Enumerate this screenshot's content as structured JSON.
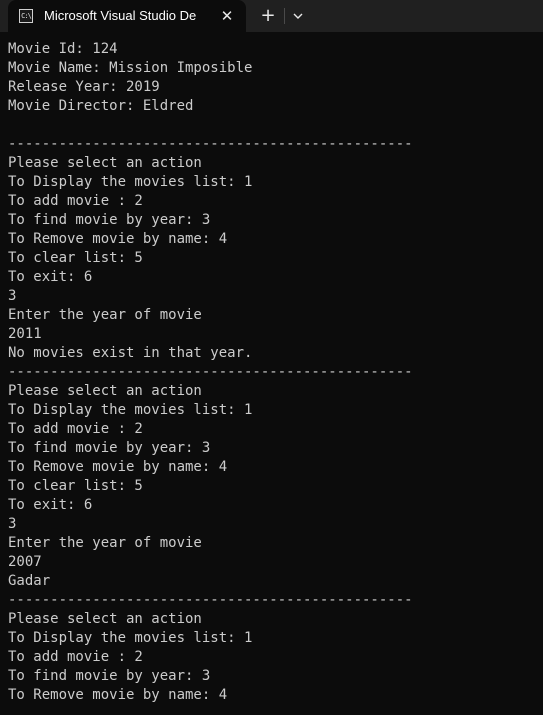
{
  "window": {
    "tab_title": "Microsoft Visual Studio Debug Console",
    "tab_icon": "console-icon",
    "close_icon": "close-icon",
    "new_tab_icon": "plus-icon",
    "dropdown_icon": "chevron-down-icon"
  },
  "terminal": {
    "lines": [
      "Movie Id: 124",
      "Movie Name: Mission Imposible",
      "Release Year: 2019",
      "Movie Director: Eldred",
      "",
      "------------------------------------------------",
      "Please select an action",
      "To Display the movies list: 1",
      "To add movie : 2",
      "To find movie by year: 3",
      "To Remove movie by name: 4",
      "To clear list: 5",
      "To exit: 6",
      "3",
      "Enter the year of movie",
      "2011",
      "No movies exist in that year.",
      "------------------------------------------------",
      "Please select an action",
      "To Display the movies list: 1",
      "To add movie : 2",
      "To find movie by year: 3",
      "To Remove movie by name: 4",
      "To clear list: 5",
      "To exit: 6",
      "3",
      "Enter the year of movie",
      "2007",
      "Gadar",
      "------------------------------------------------",
      "Please select an action",
      "To Display the movies list: 1",
      "To add movie : 2",
      "To find movie by year: 3",
      "To Remove movie by name: 4"
    ]
  }
}
